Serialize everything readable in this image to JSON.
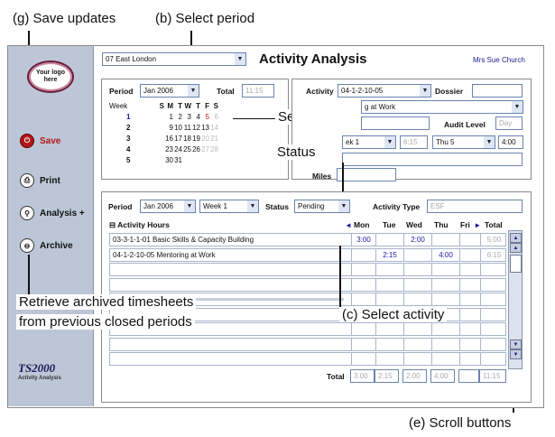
{
  "callouts": {
    "save_updates": "(g) Save updates",
    "select_period": "(b) Select period",
    "select_date": "Select date",
    "status": "Status",
    "retrieve_line1": "Retrieve archived timesheets",
    "retrieve_line2": "from previous closed periods",
    "select_activity": "(c) Select activity",
    "scroll_buttons": "(e) Scroll buttons"
  },
  "sidebar": {
    "logo_text": "Your logo here",
    "items": [
      {
        "label": "Save",
        "icon": "power-icon"
      },
      {
        "label": "Print",
        "icon": "print-icon"
      },
      {
        "label": "Analysis +",
        "icon": "search-icon"
      },
      {
        "label": "Archive",
        "icon": "archive-icon"
      }
    ],
    "brand": "TS2000",
    "brand_sub": "Activity Analysis"
  },
  "header": {
    "location": "07 East London",
    "title": "Activity Analysis",
    "user": "Mrs Sue Church"
  },
  "period_panel": {
    "period_label": "Period",
    "period_value": "Jan 2006",
    "total_label": "Total",
    "total_value": "11:15",
    "week_label": "Week",
    "day_headers": [
      "S",
      "M",
      "T",
      "W",
      "T",
      "F",
      "S"
    ],
    "weeks": [
      {
        "week": "1",
        "days": [
          "",
          "1",
          "2",
          "3",
          "4",
          "5",
          "6"
        ]
      },
      {
        "week": "2",
        "days": [
          "",
          "9",
          "10",
          "11",
          "12",
          "13",
          "14"
        ]
      },
      {
        "week": "3",
        "days": [
          "",
          "16",
          "17",
          "18",
          "19",
          "20",
          "21"
        ]
      },
      {
        "week": "4",
        "days": [
          "",
          "23",
          "24",
          "25",
          "26",
          "27",
          "28"
        ]
      },
      {
        "week": "5",
        "days": [
          "",
          "30",
          "31",
          "",
          "",
          "",
          ""
        ]
      }
    ]
  },
  "activity_panel": {
    "activity_label": "Activity",
    "activity_value": "04-1-2-10-05",
    "dossier_label": "Dossier",
    "description": "g at Work",
    "audit_label": "Audit Level",
    "audit_value": "Day",
    "week_value": "ek 1",
    "time_value": "6:15",
    "day_value": "Thu 5",
    "hours_value": "4:00",
    "miles_label": "Miles"
  },
  "filter": {
    "period_label": "Period",
    "period_value": "Jan 2006",
    "week_value": "Week 1",
    "status_label": "Status",
    "status_value": "Pending",
    "activity_type_label": "Activity Type",
    "activity_type_value": "ESF"
  },
  "grid": {
    "header_label": "Activity Hours",
    "columns": [
      "Mon",
      "Tue",
      "Wed",
      "Thu",
      "Fri",
      "Total"
    ],
    "rows": [
      {
        "activity": "03-3-1-1-01 Basic Skills & Capacity Building",
        "mon": "3:00",
        "tue": "",
        "wed": "2:00",
        "thu": "",
        "fri": "",
        "total": "5:00"
      },
      {
        "activity": "04-1-2-10-05 Mentoring at Work",
        "mon": "",
        "tue": "2:15",
        "wed": "",
        "thu": "4:00",
        "fri": "",
        "total": "6:15"
      }
    ],
    "total_label": "Total",
    "totals": [
      "3:00",
      "2:15",
      "2:00",
      "4:00",
      "",
      "11:15"
    ]
  }
}
